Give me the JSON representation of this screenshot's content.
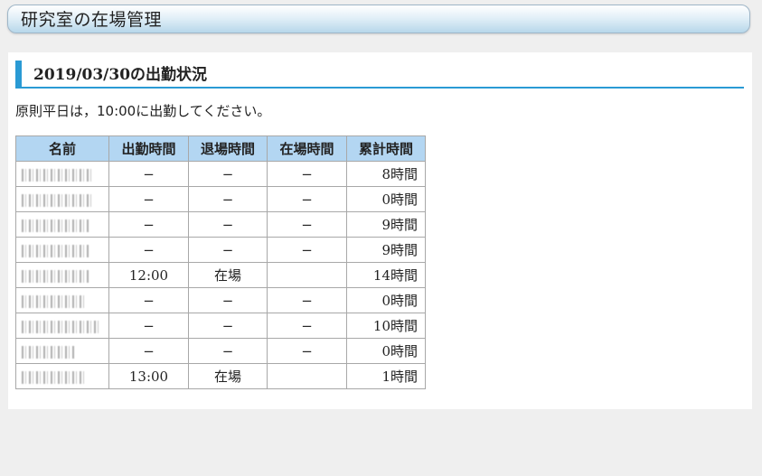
{
  "header": {
    "title": "研究室の在場管理"
  },
  "section": {
    "heading": "2019/03/30の出勤状況"
  },
  "notice": "原則平日は，10:00に出勤してください。",
  "table": {
    "columns": [
      "名前",
      "出勤時間",
      "退場時間",
      "在場時間",
      "累計時間"
    ],
    "rows": [
      {
        "name_width": 78,
        "check_in": "−",
        "check_out": "−",
        "stay": "−",
        "total": "8時間"
      },
      {
        "name_width": 80,
        "check_in": "−",
        "check_out": "−",
        "stay": "−",
        "total": "0時間"
      },
      {
        "name_width": 76,
        "check_in": "−",
        "check_out": "−",
        "stay": "−",
        "total": "9時間"
      },
      {
        "name_width": 74,
        "check_in": "−",
        "check_out": "−",
        "stay": "−",
        "total": "9時間"
      },
      {
        "name_width": 74,
        "check_in": "12:00",
        "check_out": "在場",
        "stay": "",
        "total": "14時間"
      },
      {
        "name_width": 70,
        "check_in": "−",
        "check_out": "−",
        "stay": "−",
        "total": "0時間"
      },
      {
        "name_width": 86,
        "check_in": "−",
        "check_out": "−",
        "stay": "−",
        "total": "10時間"
      },
      {
        "name_width": 60,
        "check_in": "−",
        "check_out": "−",
        "stay": "−",
        "total": "0時間"
      },
      {
        "name_width": 72,
        "check_in": "13:00",
        "check_out": "在場",
        "stay": "",
        "total": "1時間"
      }
    ]
  }
}
